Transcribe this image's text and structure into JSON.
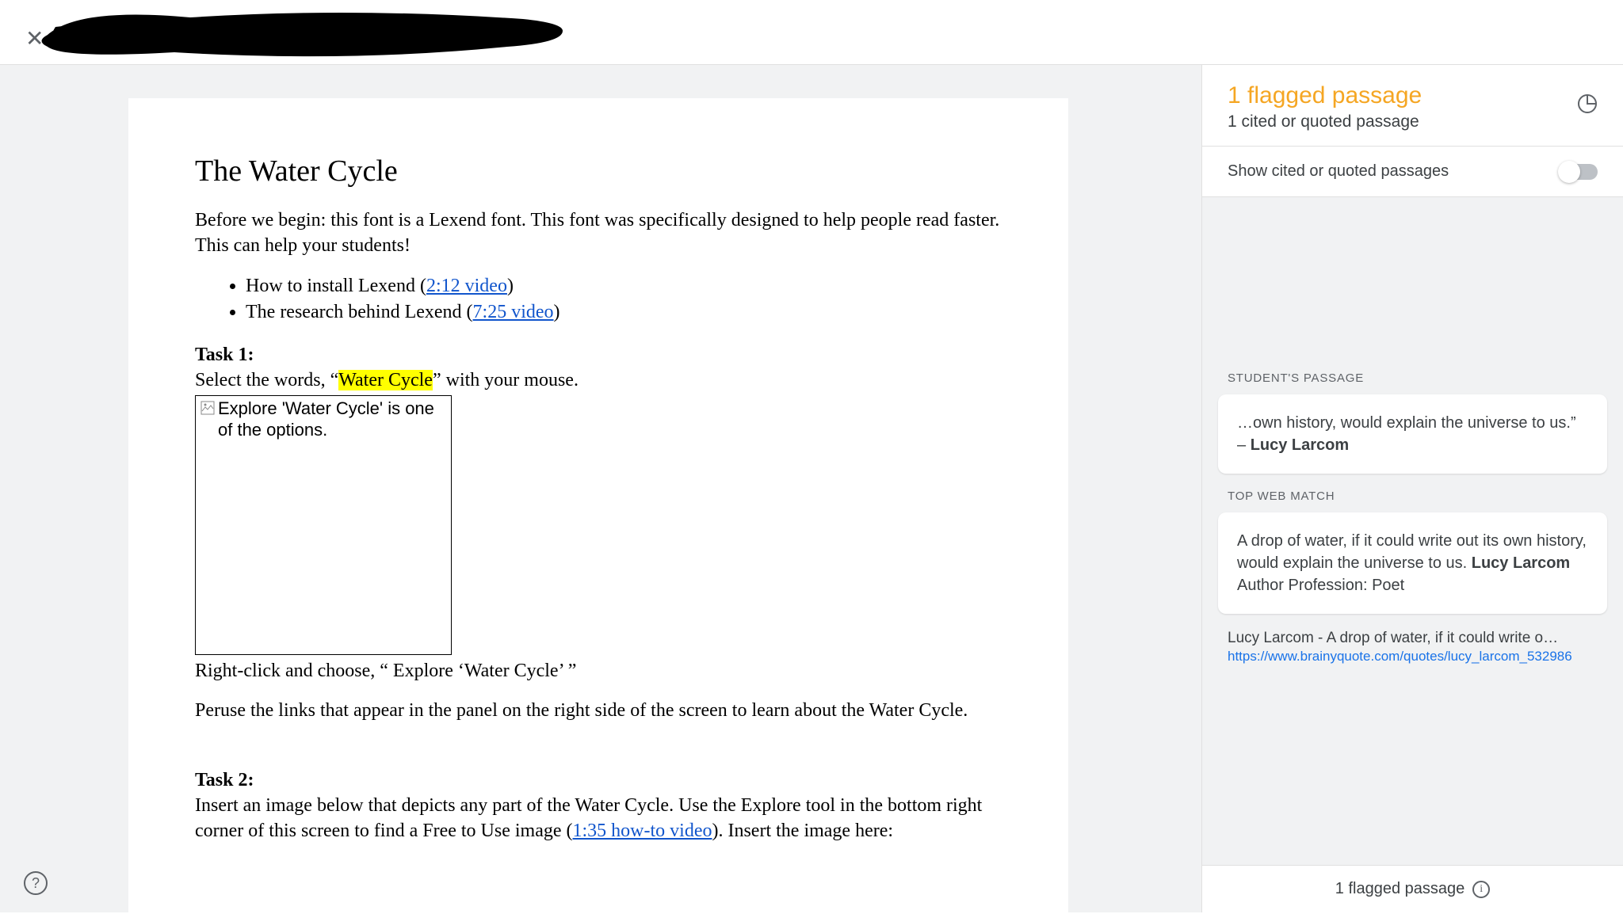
{
  "topbar": {
    "close_glyph": "✕"
  },
  "doc": {
    "title": "The Water Cycle",
    "intro": "Before we begin: this font is a Lexend font. This font was specifically designed to help people read faster. This can help your students!",
    "bullet1_pre": "How to install Lexend (",
    "bullet1_link": "2:12 video",
    "bullet1_post": ")",
    "bullet2_pre": "The research behind Lexend (",
    "bullet2_link": "7:25 video",
    "bullet2_post": ")",
    "task1_label": "Task 1:",
    "task1_line_pre": "Select the words,  “",
    "task1_highlight": "Water Cycle",
    "task1_line_post": "” with your mouse.",
    "img_alt": "Explore 'Water Cycle' is one of the options.",
    "task1_after_img": "Right-click and choose, “ Explore ‘Water Cycle’ ”",
    "task1_peruse": "Peruse the links that appear in the panel on the right side of the screen to learn about the Water Cycle.",
    "task2_label": "Task 2:",
    "task2_line_pre": "Insert an image below that depicts any part of the Water Cycle. Use the Explore tool in the bottom right corner of this screen to find a Free to Use image (",
    "task2_link": "1:35 how-to video",
    "task2_line_post": "). Insert the image here:"
  },
  "sidebar": {
    "flagged_title": "1 flagged passage",
    "cited_sub": "1 cited or quoted passage",
    "toggle_label": "Show cited or quoted passages",
    "student_label": "STUDENT'S PASSAGE",
    "student_quote_pre": "…own history, would explain the universe to us.” – ",
    "student_quote_author": "Lucy Larcom",
    "match_label": "TOP WEB MATCH",
    "match_text_pre": "A drop of water, if it could write out its own history, would explain the universe to us. ",
    "match_text_bold": "Lucy Larcom",
    "match_text_post": " Author Profession: Poet",
    "match_title": "Lucy Larcom - A drop of water, if it could write o…",
    "match_url": "https://www.brainyquote.com/quotes/lucy_larcom_532986",
    "footer": "1 flagged passage",
    "info_glyph": "i"
  },
  "help": {
    "glyph": "?"
  }
}
